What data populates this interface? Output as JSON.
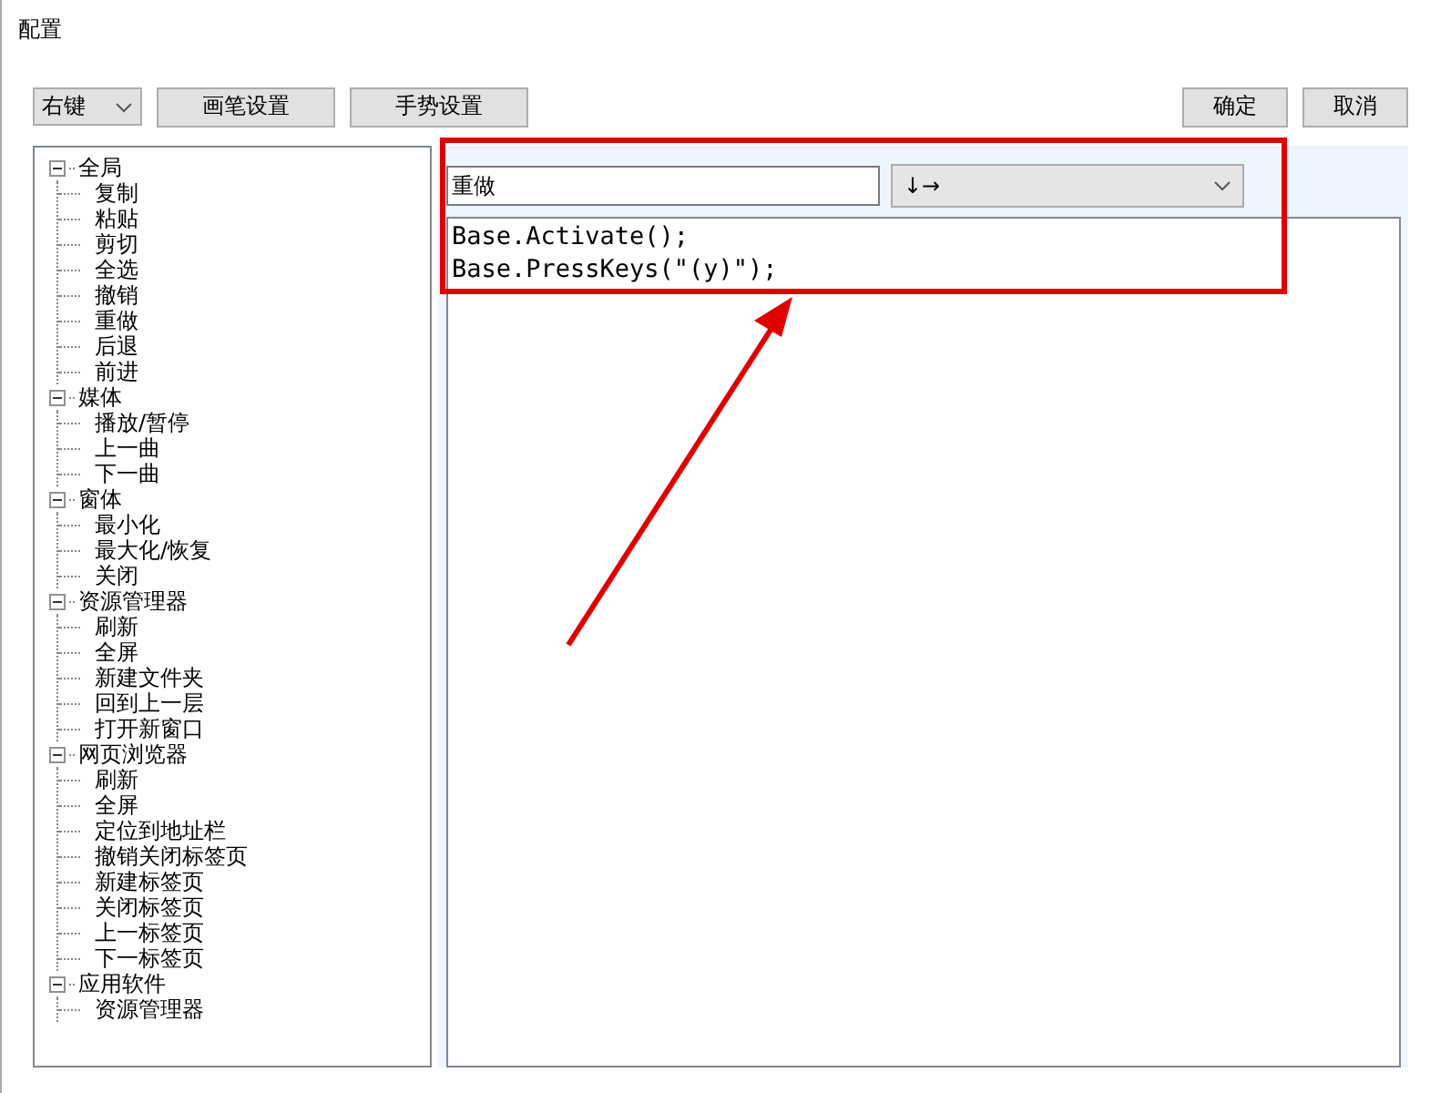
{
  "window": {
    "title": "配置"
  },
  "toolbar": {
    "mode_select": {
      "value": "右键"
    },
    "buttons": [
      "画笔设置",
      "手势设置"
    ],
    "dialog_buttons": [
      "确定",
      "取消"
    ]
  },
  "tree": [
    {
      "label": "全局",
      "expanded": true,
      "children": [
        {
          "label": "复制"
        },
        {
          "label": "粘贴"
        },
        {
          "label": "剪切"
        },
        {
          "label": "全选"
        },
        {
          "label": "撤销"
        },
        {
          "label": "重做"
        },
        {
          "label": "后退"
        },
        {
          "label": "前进"
        }
      ]
    },
    {
      "label": "媒体",
      "expanded": true,
      "children": [
        {
          "label": "播放/暂停"
        },
        {
          "label": "上一曲"
        },
        {
          "label": "下一曲"
        }
      ]
    },
    {
      "label": "窗体",
      "expanded": true,
      "children": [
        {
          "label": "最小化"
        },
        {
          "label": "最大化/恢复"
        },
        {
          "label": "关闭"
        }
      ]
    },
    {
      "label": "资源管理器",
      "expanded": true,
      "children": [
        {
          "label": "刷新"
        },
        {
          "label": "全屏"
        },
        {
          "label": "新建文件夹"
        },
        {
          "label": "回到上一层"
        },
        {
          "label": "打开新窗口"
        }
      ]
    },
    {
      "label": "网页浏览器",
      "expanded": true,
      "children": [
        {
          "label": "刷新"
        },
        {
          "label": "全屏"
        },
        {
          "label": "定位到地址栏"
        },
        {
          "label": "撤销关闭标签页"
        },
        {
          "label": "新建标签页"
        },
        {
          "label": "关闭标签页"
        },
        {
          "label": "上一标签页"
        },
        {
          "label": "下一标签页"
        }
      ]
    },
    {
      "label": "应用软件",
      "expanded": true,
      "children": [
        {
          "label": "资源管理器"
        }
      ]
    }
  ],
  "editor": {
    "name_field": {
      "value": "重做"
    },
    "gesture_select": {
      "value": "↓→"
    },
    "code_lines": [
      "Base.Activate();",
      "Base.PressKeys(\"(y)\");"
    ]
  }
}
